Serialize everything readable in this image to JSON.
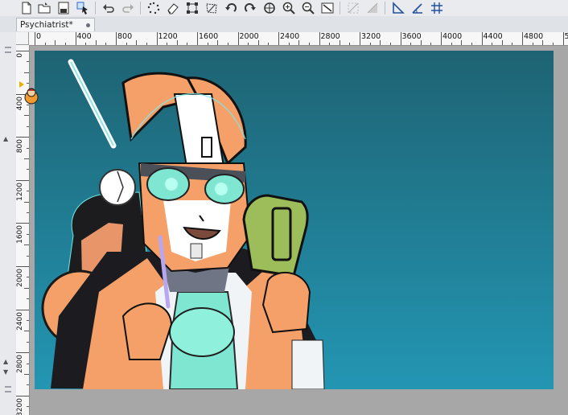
{
  "document": {
    "tab_title": "Psychiatrist*"
  },
  "toolbar": {
    "tools": [
      "new-file-icon",
      "open-folder-icon",
      "save-icon",
      "select-arrow-icon",
      "undo-icon",
      "redo-icon",
      "marquee-icon",
      "eraser-icon",
      "transform-icon",
      "warp-icon",
      "rotate-left-icon",
      "rotate-right-icon",
      "move-view-icon",
      "zoom-in-icon",
      "zoom-out-icon",
      "fit-screen-icon",
      "ruler-off-icon",
      "perspective-off-icon",
      "ruler-icon",
      "angle-ruler-icon",
      "grid-icon"
    ]
  },
  "rulers": {
    "horizontal_labels": [
      "0",
      "400",
      "800",
      "1200",
      "1600",
      "2000",
      "2400",
      "2800",
      "3200",
      "3600",
      "4000",
      "4400",
      "4800",
      "52"
    ],
    "vertical_labels": [
      "0",
      "400",
      "800",
      "1200",
      "1600",
      "2000",
      "2400",
      "2800",
      "3200"
    ]
  },
  "canvas": {
    "background_top": "#1e6373",
    "background_bottom": "#2396b3",
    "accent_orange": "#f5a068",
    "accent_mint": "#7fe6d2",
    "accent_green": "#9cbd5a"
  }
}
